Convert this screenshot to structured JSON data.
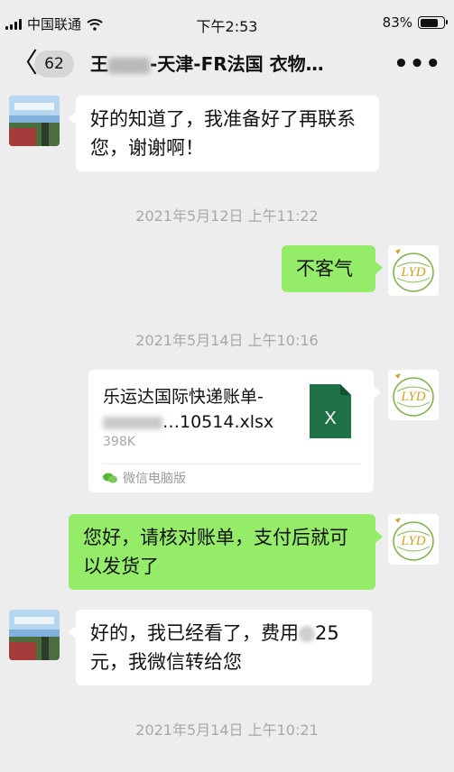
{
  "status_bar": {
    "carrier": "中国联通",
    "time": "下午2:53",
    "battery": "83%",
    "battery_level": 0.83
  },
  "nav": {
    "back_label": "〈",
    "unread": "62",
    "title_prefix": "王",
    "title_suffix": "-天津-FR法国 衣物…",
    "more_label": "•••"
  },
  "messages": [
    {
      "text": "好的知道了，我准备好了再联系您，谢谢啊！"
    },
    {
      "timestamp": "2021年5月12日 上午11:22"
    },
    {
      "text": "不客气"
    },
    {
      "timestamp": "2021年5月14日 上午10:16"
    },
    {
      "file_name_line1": "乐运达国际快递账单-",
      "file_name_line2": "…10514.xlsx",
      "file_size": "398K",
      "file_source": "微信电脑版",
      "file_icon_label": "X"
    },
    {
      "text": "您好，请核对账单，支付后就可以发货了"
    },
    {
      "text_part1": "好的，我已经看了，费用",
      "text_part2": "25元，我微信转给您"
    },
    {
      "timestamp": "2021年5月14日 上午10:21"
    }
  ],
  "colors": {
    "background": "#ededed",
    "sent_bubble": "#95ec69",
    "received_bubble": "#ffffff",
    "timestamp": "#a8a8a8",
    "excel_green": "#1f7146"
  }
}
